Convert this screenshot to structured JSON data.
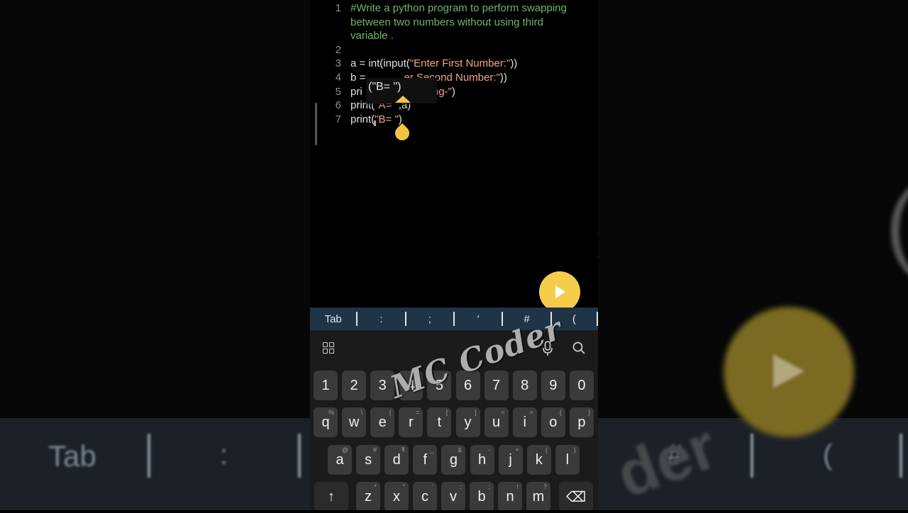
{
  "editor": {
    "lines": [
      {
        "num": "1",
        "parts": [
          {
            "t": "#Write a python program to perform swapping",
            "c": "comment"
          }
        ]
      },
      {
        "num": "",
        "parts": [
          {
            "t": "between two numbers without using third",
            "c": "comment"
          }
        ]
      },
      {
        "num": "",
        "parts": [
          {
            "t": "variable .",
            "c": "comment"
          }
        ]
      },
      {
        "num": "2",
        "parts": []
      },
      {
        "num": "3",
        "parts": [
          {
            "t": "a = int(input(",
            "c": ""
          },
          {
            "t": "\"Enter First Number:\"",
            "c": "str"
          },
          {
            "t": "))",
            "c": ""
          }
        ]
      },
      {
        "num": "4",
        "parts": [
          {
            "t": "b = ",
            "c": ""
          },
          {
            "t": "            ",
            "c": ""
          },
          {
            "t": "er Second Number:\"",
            "c": "str"
          },
          {
            "t": "))",
            "c": ""
          }
        ]
      },
      {
        "num": "5",
        "parts": [
          {
            "t": "pri",
            "c": ""
          },
          {
            "t": "                   ",
            "c": ""
          },
          {
            "t": "pping-\"",
            "c": "str"
          },
          {
            "t": ")",
            "c": ""
          }
        ]
      },
      {
        "num": "6",
        "parts": [
          {
            "t": "print(",
            "c": ""
          },
          {
            "t": "\"A= \"",
            "c": "str"
          },
          {
            "t": ",a)",
            "c": ""
          }
        ]
      },
      {
        "num": "7",
        "parts": [
          {
            "t": "print(",
            "c": ""
          },
          {
            "t": "\"B= \"",
            "c": "str"
          },
          {
            "t": ")",
            "c": ""
          }
        ]
      }
    ],
    "popup_text": "(\"B= \")",
    "popup_ghost": "(\"A= \",a)"
  },
  "run_button": {
    "icon": "play-icon"
  },
  "symbol_bar": {
    "tab": "Tab",
    "symbols": [
      ":",
      ";",
      "'",
      "#",
      "("
    ]
  },
  "keyboard": {
    "toolbar_icons": [
      "grid-icon",
      "mic-icon",
      "search-icon"
    ],
    "rows": [
      [
        {
          "k": "1"
        },
        {
          "k": "2"
        },
        {
          "k": "3"
        },
        {
          "k": "4"
        },
        {
          "k": "5"
        },
        {
          "k": "6"
        },
        {
          "k": "7"
        },
        {
          "k": "8"
        },
        {
          "k": "9"
        },
        {
          "k": "0"
        }
      ],
      [
        {
          "k": "q",
          "h": "%"
        },
        {
          "k": "w",
          "h": "\\"
        },
        {
          "k": "e",
          "h": "|"
        },
        {
          "k": "r",
          "h": "="
        },
        {
          "k": "t",
          "h": "["
        },
        {
          "k": "y",
          "h": "]"
        },
        {
          "k": "u",
          "h": "<"
        },
        {
          "k": "i",
          "h": ">"
        },
        {
          "k": "o",
          "h": "{"
        },
        {
          "k": "p",
          "h": "}"
        }
      ],
      [
        {
          "k": "a",
          "h": "@"
        },
        {
          "k": "s",
          "h": "#"
        },
        {
          "k": "d",
          "h": "₹"
        },
        {
          "k": "f",
          "h": "_"
        },
        {
          "k": "g",
          "h": "&"
        },
        {
          "k": "h",
          "h": "-"
        },
        {
          "k": "j",
          "h": "+"
        },
        {
          "k": "k",
          "h": "("
        },
        {
          "k": "l",
          "h": ")"
        }
      ],
      [
        {
          "k": "↑"
        },
        {
          "k": "z",
          "h": "*"
        },
        {
          "k": "x",
          "h": "\""
        },
        {
          "k": "c",
          "h": "'"
        },
        {
          "k": "v",
          "h": ":"
        },
        {
          "k": "b",
          "h": ";"
        },
        {
          "k": "n",
          "h": "!"
        },
        {
          "k": "m",
          "h": "?"
        },
        {
          "k": "⌫"
        }
      ]
    ]
  },
  "watermark": "MC Coder",
  "background": {
    "tab": "Tab",
    "chars": [
      ":",
      "#",
      "("
    ],
    "paren": "(",
    "watermark_fragment": "der"
  },
  "colors": {
    "accent": "#f5cd4a",
    "symbol_bar": "#1f3547",
    "comment": "#6fb36c",
    "string": "#f0a68a"
  }
}
